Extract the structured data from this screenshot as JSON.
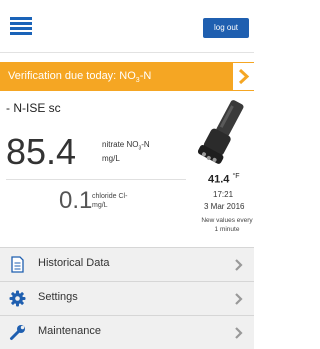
{
  "colors": {
    "accent": "#1f5fb0",
    "banner": "#f5a623",
    "menu_bg": "#f0f0f0"
  },
  "header": {
    "menu_icon": "hamburger-menu-icon",
    "logout_label": "log out"
  },
  "banner": {
    "text": "Verification due today: NO",
    "sub": "3",
    "suffix": "-N",
    "arrow_icon": "chevron-right-icon"
  },
  "sensor": {
    "name": "- N-ISE sc",
    "primary": {
      "value": "85.4",
      "label_line1": "nitrate NO",
      "label_sub": "3",
      "label_suffix": "-N",
      "unit": "mg/L"
    },
    "secondary": {
      "value": "0.1",
      "label_line1": "chloride Cl-",
      "unit": "mg/L"
    },
    "image_icon": "sensor-probe-icon"
  },
  "status": {
    "temperature": "41.4",
    "temp_unit": "°F",
    "time": "17:21",
    "date": "3 Mar 2016",
    "note": "New values every 1 minute"
  },
  "menu": [
    {
      "label": "Historical Data",
      "icon": "document-icon"
    },
    {
      "label": "Settings",
      "icon": "gear-icon"
    },
    {
      "label": "Maintenance",
      "icon": "wrench-icon"
    }
  ]
}
